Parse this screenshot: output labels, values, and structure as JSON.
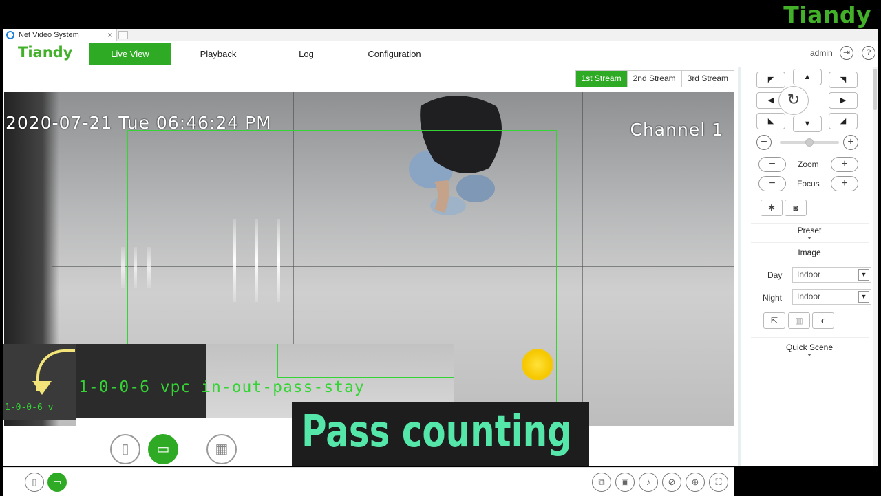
{
  "watermark": {
    "logo": "Tiandy"
  },
  "browser": {
    "tab_title": "Net Video System",
    "tab_close": "×"
  },
  "appbar": {
    "brand": "Tiandy",
    "nav": [
      "Live View",
      "Playback",
      "Log",
      "Configuration"
    ],
    "active_nav": "Live View",
    "user": "admin",
    "logout_icon": "logout-icon",
    "help_icon": "help-icon",
    "help_glyph": "?"
  },
  "streams": {
    "items": [
      "1st Stream",
      "2nd Stream",
      "3rd Stream"
    ],
    "active": "1st Stream"
  },
  "video": {
    "timestamp": "2020-07-21 Tue 06:46:24 PM",
    "channel": "Channel 1"
  },
  "overlay": {
    "zoom_text": "1-0-0-6 vpc in-out-pass-stay",
    "snippet_text": "1-0-0-6 v"
  },
  "caption": "Pass counting",
  "ptz": {
    "zoom_label": "Zoom",
    "focus_label": "Focus",
    "minus": "−",
    "plus": "+"
  },
  "panel": {
    "preset_title": "Preset",
    "image_title": "Image",
    "day_label": "Day",
    "day_value": "Indoor",
    "night_label": "Night",
    "night_value": "Indoor",
    "quick_scene_title": "Quick Scene"
  },
  "colors": {
    "accent_green": "#2eaa24",
    "brand_green": "#43b02a",
    "osd_green": "#35d435",
    "caption_text": "#55e6a9"
  }
}
